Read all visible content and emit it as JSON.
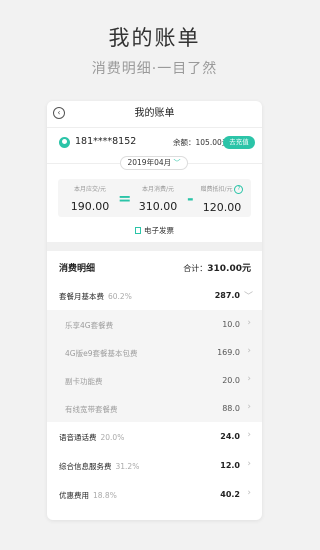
{
  "hero": {
    "title": "我的账单",
    "subtitle": "消费明细·一目了然"
  },
  "app": {
    "title": "我的账单",
    "back_icon": "back-circle-icon",
    "account": {
      "phone": "181****8152",
      "balance": "余额：105.00元",
      "recharge_label": "去充值"
    },
    "month": {
      "label": "2019年04月",
      "icon": "chevron-down-icon"
    },
    "summary": {
      "payable_label": "本月应交/元",
      "payable_value": "190.00",
      "consumption_label": "本月消费/元",
      "consumption_value": "310.00",
      "deduction_label": "赠费抵扣/元",
      "deduction_value": "120.00",
      "equals": "=",
      "minus": "-"
    },
    "invoice_label": "电子发票",
    "detail": {
      "title": "消费明细",
      "total_label": "合计：",
      "total_value": "310.00元",
      "rows": [
        {
          "name": "套餐月基本费",
          "pct": "60.2%",
          "amount": "287.0",
          "expanded": true
        },
        {
          "name": "语音通话费",
          "pct": "20.0%",
          "amount": "24.0"
        },
        {
          "name": "综合信息服务费",
          "pct": "31.2%",
          "amount": "12.0"
        },
        {
          "name": "优惠费用",
          "pct": "18.8%",
          "amount": "40.2"
        }
      ],
      "sub_rows": [
        {
          "name": "乐享4G套餐费",
          "amount": "10.0"
        },
        {
          "name": "4G版e9套餐基本包费",
          "amount": "169.0"
        },
        {
          "name": "副卡功能费",
          "amount": "20.0"
        },
        {
          "name": "有线宽带套餐费",
          "amount": "88.0"
        }
      ]
    }
  },
  "colors": {
    "accent": "#2bc4a8",
    "background": "#f2f2f2"
  }
}
